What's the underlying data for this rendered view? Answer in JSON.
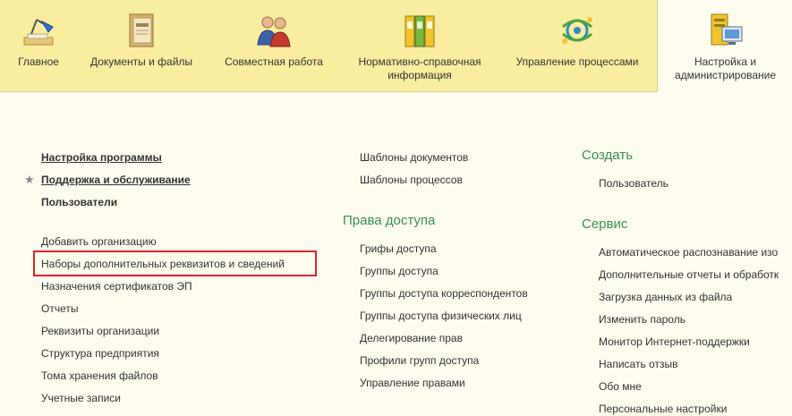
{
  "sections": [
    {
      "label": "Главное",
      "icon": "desk-lamp-icon"
    },
    {
      "label": "Документы и файлы",
      "icon": "binder-icon"
    },
    {
      "label": "Совместная работа",
      "icon": "people-icon"
    },
    {
      "label": "Нормативно-справочная информация",
      "icon": "folders-icon"
    },
    {
      "label": "Управление процессами",
      "icon": "gears-icon"
    },
    {
      "label": "Настройка и администрирование",
      "icon": "server-monitor-icon"
    }
  ],
  "col1": {
    "top_links": [
      "Настройка программы",
      "Поддержка и обслуживание",
      "Пользователи"
    ],
    "links": [
      "Добавить организацию",
      "Наборы дополнительных реквизитов и сведений",
      "Назначения сертификатов ЭП",
      "Отчеты",
      "Реквизиты организации",
      "Структура предприятия",
      "Тома хранения файлов",
      "Учетные записи"
    ]
  },
  "col2": {
    "links_top": [
      "Шаблоны документов",
      "Шаблоны процессов"
    ],
    "group_title": "Права доступа",
    "links": [
      "Грифы доступа",
      "Группы доступа",
      "Группы доступа корреспондентов",
      "Группы доступа физических лиц",
      "Делегирование прав",
      "Профили групп доступа",
      "Управление правами"
    ]
  },
  "col3": {
    "create_title": "Создать",
    "create_links": [
      "Пользователь"
    ],
    "service_title": "Сервис",
    "service_links": [
      "Автоматическое распознавание изо",
      "Дополнительные отчеты и обработк",
      "Загрузка данных из файла",
      "Изменить пароль",
      "Монитор Интернет-поддержки",
      "Написать отзыв",
      "Обо мне",
      "Персональные настройки"
    ]
  },
  "colors": {
    "topbar": "#f9eda0",
    "group_title": "#3a8f52",
    "highlight": "#e0222b"
  }
}
